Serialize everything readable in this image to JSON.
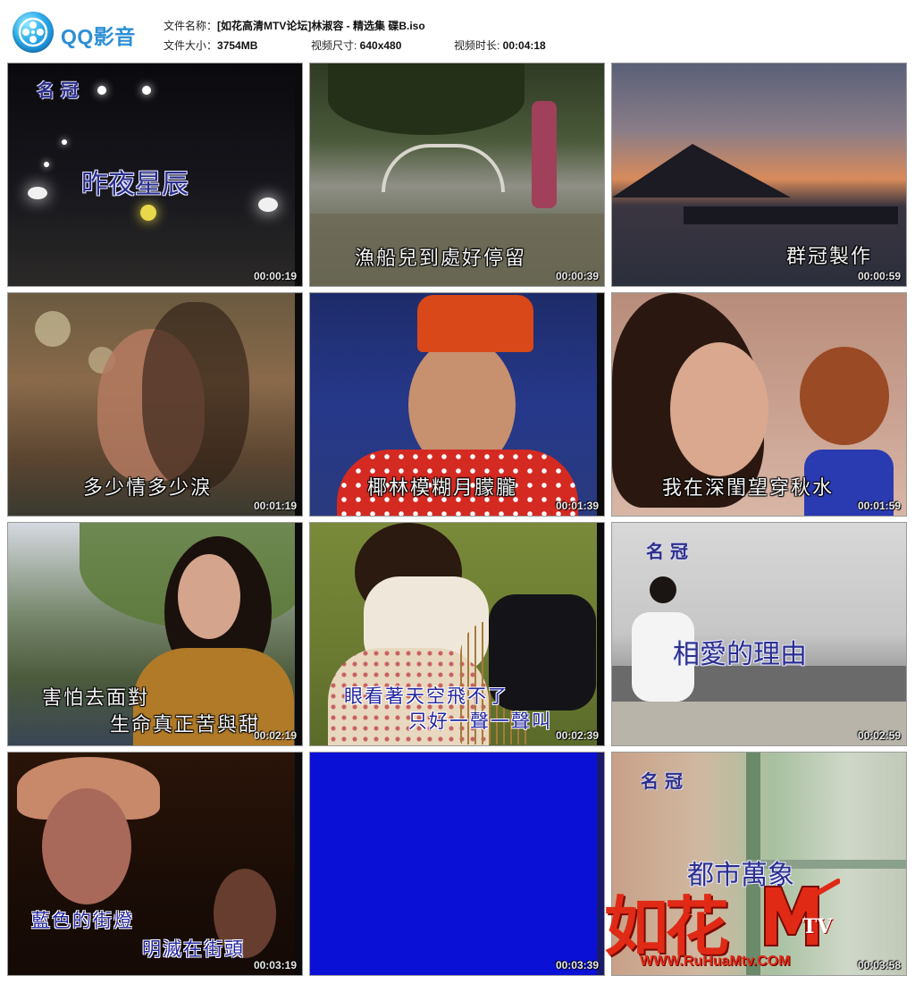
{
  "app": {
    "name": "QQ影音",
    "icon": "film-reel-icon"
  },
  "file_info": {
    "name_label": "文件名称：",
    "name_value": "[如花高清MTV论坛]林淑容 - 精选集 碟B.iso",
    "size_label": "文件大小：",
    "size_value": "3754MB",
    "dims_label": "视频尺寸: ",
    "dims_value": "640x480",
    "duration_label": "视频时长: ",
    "duration_value": "00:04:18"
  },
  "thumbnails": [
    {
      "timestamp": "00:00:19",
      "tag": "名 冠",
      "title": "昨夜星辰",
      "lines": []
    },
    {
      "timestamp": "00:00:39",
      "lines": [
        "漁船兒到處好停留"
      ]
    },
    {
      "timestamp": "00:00:59",
      "lines": [
        "群冠製作"
      ]
    },
    {
      "timestamp": "00:01:19",
      "lines": [
        "多少情多少淚"
      ]
    },
    {
      "timestamp": "00:01:39",
      "lines": [
        "椰林模糊月朦朧"
      ]
    },
    {
      "timestamp": "00:01:59",
      "lines": [
        "我在深閨望穿秋水"
      ]
    },
    {
      "timestamp": "00:02:19",
      "lines": [
        "害怕去面對",
        "生命真正苦與甜"
      ]
    },
    {
      "timestamp": "00:02:39",
      "lines": [
        "眼看著天空飛不了",
        "只好一聲一聲叫"
      ]
    },
    {
      "timestamp": "00:02:59",
      "tag": "名 冠",
      "title": "相愛的理由",
      "lines": []
    },
    {
      "timestamp": "00:03:19",
      "lines": [
        "藍色的街燈",
        "明滅在街頭"
      ]
    },
    {
      "timestamp": "00:03:39",
      "lines": []
    },
    {
      "timestamp": "00:03:58",
      "tag": "名 冠",
      "title": "都市萬象",
      "lines": []
    }
  ],
  "watermark": {
    "logo_text": "如花",
    "mtv_text": "TV",
    "url": "WWW.RuHuaMtv.COM"
  }
}
